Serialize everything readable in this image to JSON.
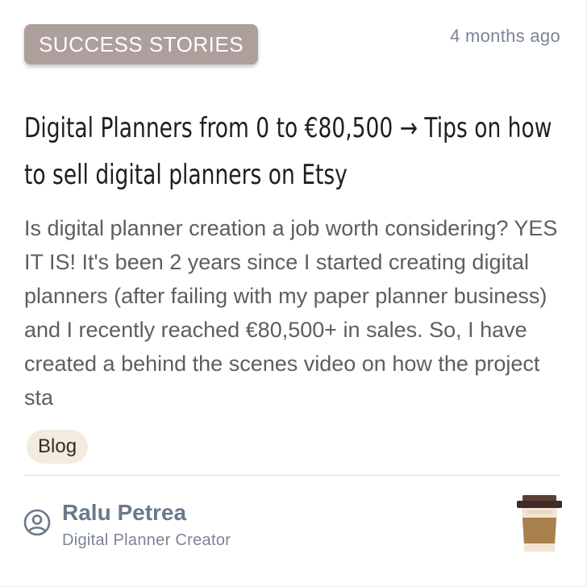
{
  "post": {
    "category": "SUCCESS STORIES",
    "timestamp": "4 months ago",
    "title": "Digital Planners from 0 to €80,500 → Tips on how to sell digital planners on Etsy",
    "excerpt": "Is digital planner creation a job worth considering? YES IT IS! It's been 2 years since I started creating digital planners (after failing with my paper planner business) and I recently reached €80,500+ in sales. So, I have created a behind the scenes video on how the project sta",
    "tag": "Blog"
  },
  "author": {
    "name": "Ralu Petrea",
    "role": "Digital Planner Creator",
    "avatar_icon": "user-circle-icon"
  },
  "badge_icon": "coffee-cup-icon",
  "colors": {
    "category_badge": "#ad9f9c",
    "tag_chip": "#f3ebdd",
    "author_name": "#6a788c"
  }
}
